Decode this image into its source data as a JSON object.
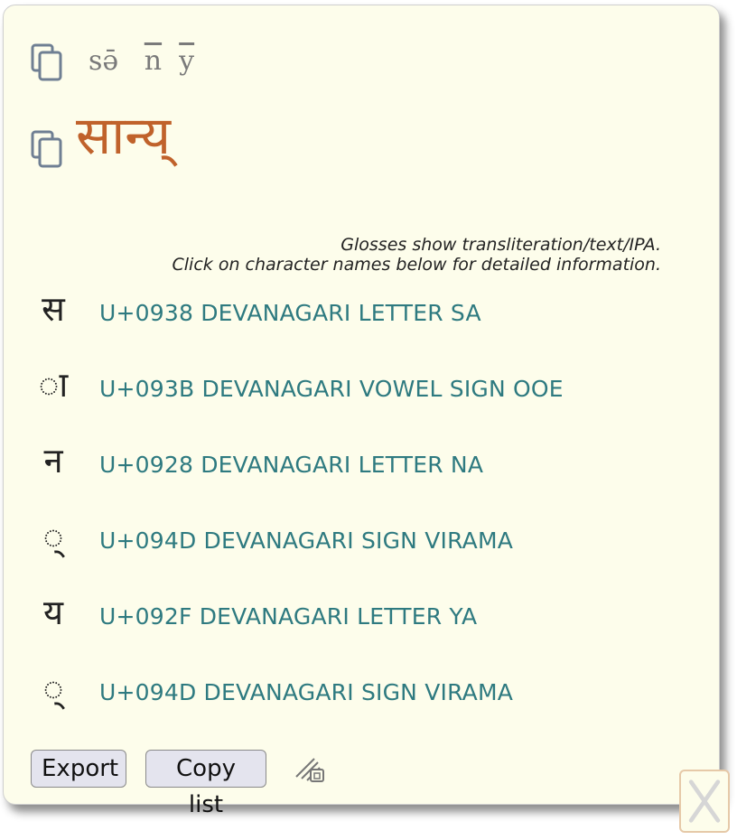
{
  "header": {
    "transliteration": {
      "part1": "sə̄",
      "part2": "n",
      "part3": "y"
    },
    "word": "सान्य्"
  },
  "note": {
    "line1": "Glosses show transliteration/text/IPA.",
    "line2": "Click on character names below for detailed information."
  },
  "characters": [
    {
      "glyph": "स",
      "name": "U+0938 DEVANAGARI LETTER SA"
    },
    {
      "glyph": "◌ा",
      "name": "U+093B DEVANAGARI VOWEL SIGN OOE"
    },
    {
      "glyph": "न",
      "name": "U+0928 DEVANAGARI LETTER NA"
    },
    {
      "glyph": "◌्",
      "name": "U+094D DEVANAGARI SIGN VIRAMA"
    },
    {
      "glyph": "य",
      "name": "U+092F DEVANAGARI LETTER YA"
    },
    {
      "glyph": "◌्",
      "name": "U+094D DEVANAGARI SIGN VIRAMA"
    }
  ],
  "buttons": {
    "export_label": "Export",
    "copy_list_label": "Copy list"
  },
  "icons": {
    "copy": "copy-icon",
    "resize": "resize-icon",
    "close": "close-icon"
  },
  "colors": {
    "panel_bg": "#fdfdeb",
    "word": "#c0622b",
    "link": "#2e7a80"
  }
}
